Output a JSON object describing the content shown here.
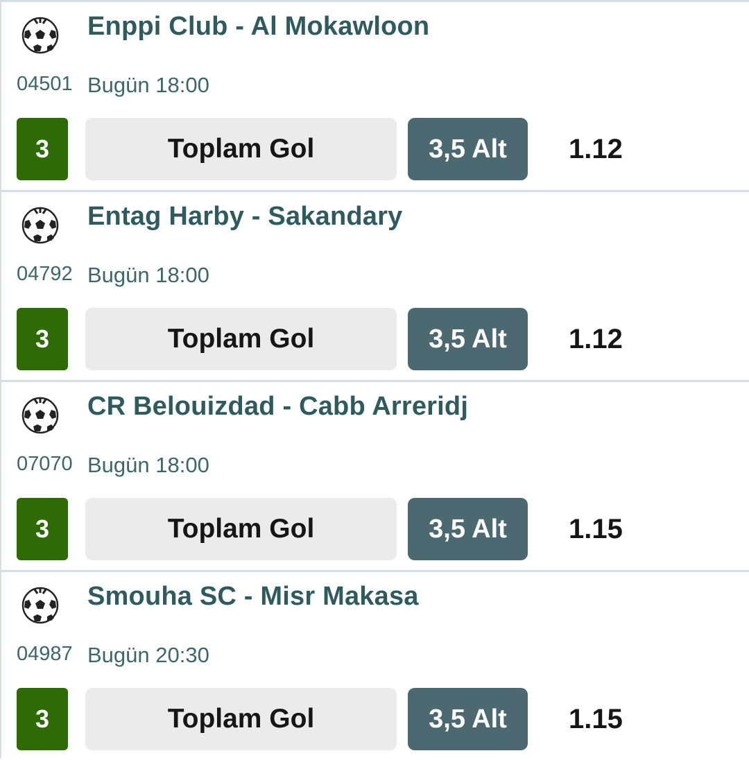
{
  "icons": {
    "sport": "soccer-ball-icon"
  },
  "colors": {
    "team_text": "#2f5a5e",
    "meta_text": "#3e6669",
    "mbs_badge": "#2e6a06",
    "market_bg": "#ebebeb",
    "selection_bg": "#4c6870",
    "divider": "#d5dee3"
  },
  "matches": [
    {
      "title": "Enppi Club - Al Mokawloon",
      "code": "04501",
      "time": "Bugün 18:00",
      "mbs": "3",
      "market": "Toplam Gol",
      "selection": "3,5 Alt",
      "odds": "1.12"
    },
    {
      "title": "Entag Harby - Sakandary",
      "code": "04792",
      "time": "Bugün 18:00",
      "mbs": "3",
      "market": "Toplam Gol",
      "selection": "3,5 Alt",
      "odds": "1.12"
    },
    {
      "title": "CR Belouizdad - Cabb Arreridj",
      "code": "07070",
      "time": "Bugün 18:00",
      "mbs": "3",
      "market": "Toplam Gol",
      "selection": "3,5 Alt",
      "odds": "1.15"
    },
    {
      "title": "Smouha SC - Misr Makasa",
      "code": "04987",
      "time": "Bugün 20:30",
      "mbs": "3",
      "market": "Toplam Gol",
      "selection": "3,5 Alt",
      "odds": "1.15"
    }
  ]
}
